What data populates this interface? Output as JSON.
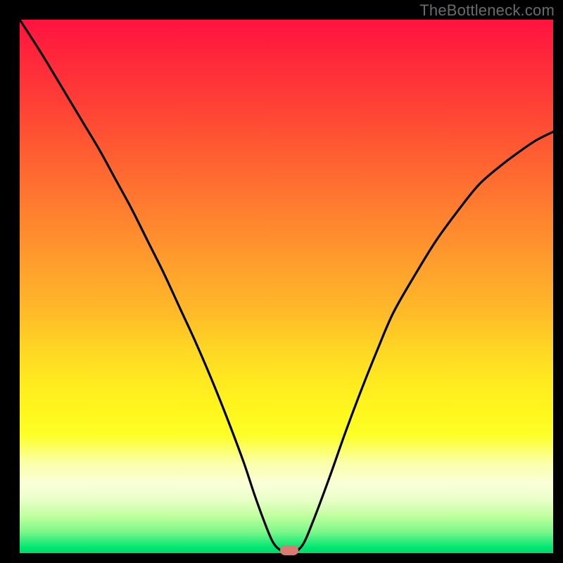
{
  "watermark": "TheBottleneck.com",
  "colors": {
    "curve_stroke": "#000000",
    "marker_fill": "#d87b72",
    "frame_bg": "#000000"
  },
  "chart_data": {
    "type": "line",
    "title": "",
    "xlabel": "",
    "ylabel": "",
    "xlim": [
      0,
      1
    ],
    "ylim": [
      0,
      1
    ],
    "series": [
      {
        "name": "curve",
        "x": [
          0.0,
          0.03,
          0.06,
          0.09,
          0.12,
          0.15,
          0.18,
          0.21,
          0.24,
          0.27,
          0.3,
          0.33,
          0.36,
          0.39,
          0.42,
          0.44,
          0.46,
          0.475,
          0.49,
          0.51,
          0.53,
          0.55,
          0.58,
          0.61,
          0.64,
          0.67,
          0.7,
          0.74,
          0.78,
          0.82,
          0.86,
          0.9,
          0.94,
          0.97,
          1.0
        ],
        "y": [
          1.0,
          0.955,
          0.905,
          0.855,
          0.805,
          0.755,
          0.7,
          0.645,
          0.585,
          0.525,
          0.46,
          0.395,
          0.325,
          0.25,
          0.17,
          0.11,
          0.055,
          0.02,
          0.005,
          0.0,
          0.015,
          0.06,
          0.14,
          0.225,
          0.305,
          0.38,
          0.45,
          0.52,
          0.585,
          0.64,
          0.69,
          0.725,
          0.755,
          0.775,
          0.79
        ]
      }
    ],
    "marker": {
      "x": 0.505,
      "y": 0.005
    }
  }
}
